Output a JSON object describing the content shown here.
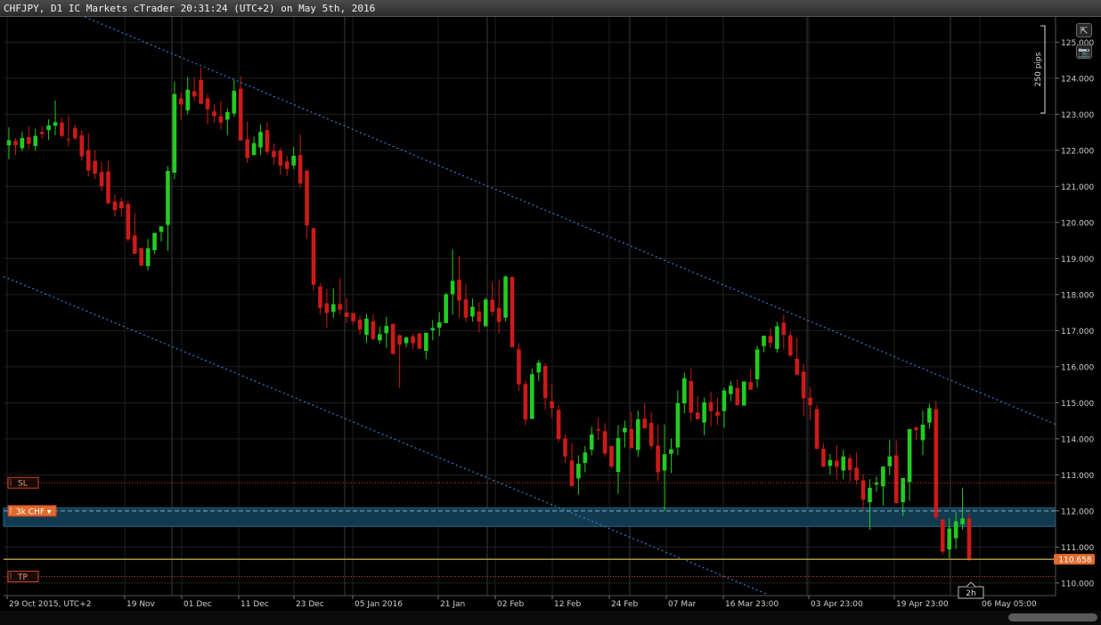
{
  "window": {
    "title": "CHFJPY, D1 IC Markets cTrader 20:31:24 (UTC+2) on May 5th, 2016"
  },
  "toolbar": {
    "expand_icon": "expand-icon",
    "camera_icon": "camera-icon",
    "expand_glyph": "⇱",
    "camera_glyph": "📷"
  },
  "chart_data": {
    "type": "candlestick",
    "symbol": "CHFJPY",
    "timeframe": "D1",
    "ylim": [
      109.65,
      125.7
    ],
    "y_ticks": [
      "110.000",
      "111.000",
      "112.000",
      "113.000",
      "114.000",
      "115.000",
      "116.000",
      "117.000",
      "118.000",
      "119.000",
      "120.000",
      "121.000",
      "122.000",
      "123.000",
      "124.000",
      "125.000"
    ],
    "x_labels": [
      "29 Oct 2015, UTC+2",
      "19 Nov",
      "01 Dec",
      "11 Dec",
      "23 Dec",
      "05 Jan 2016",
      "21 Jan",
      "02 Feb",
      "12 Feb",
      "24 Feb",
      "07 Mar",
      "16 Mar 23:00",
      "03 Apr 23:00",
      "19 Apr 23:00",
      "06 May 05:00"
    ],
    "current_price": "110.658",
    "scale_label": "250 pips",
    "countdown": "2h",
    "orders": {
      "sl": {
        "label": "SL",
        "price": 112.78
      },
      "position": {
        "label": "3k CHF",
        "price": 112.0,
        "zone": [
          111.57,
          112.08
        ]
      },
      "tp": {
        "label": "TP",
        "price": 110.18
      }
    },
    "trendlines": [
      {
        "style": "dotted",
        "from": [
          "Oct 2015",
          125.9
        ],
        "to": [
          "May 2016",
          114.4
        ]
      },
      {
        "style": "dotted",
        "from": [
          "Oct 2015",
          118.5
        ],
        "to": [
          "Mar 2016",
          109.7
        ]
      }
    ],
    "colors": {
      "up": "#22cc22",
      "down": "#cc1a1a",
      "price_tag": "#e06b2e",
      "zone": "#113a4f",
      "sl_tp": "#cc4422",
      "trend": "#2e7fd1",
      "current_line": "#b8a44a"
    },
    "candles": [
      [
        122.14,
        122.64,
        121.75,
        122.28
      ],
      [
        122.26,
        122.34,
        121.87,
        122.14
      ],
      [
        122.06,
        122.52,
        121.98,
        122.34
      ],
      [
        122.37,
        122.66,
        122.03,
        122.18
      ],
      [
        122.12,
        122.6,
        121.99,
        122.4
      ],
      [
        122.51,
        122.67,
        122.31,
        122.45
      ],
      [
        122.56,
        122.86,
        122.29,
        122.69
      ],
      [
        122.68,
        123.38,
        122.42,
        122.78
      ],
      [
        122.77,
        122.91,
        122.35,
        122.4
      ],
      [
        122.31,
        122.97,
        122.11,
        122.3
      ],
      [
        122.62,
        122.71,
        122.29,
        122.33
      ],
      [
        122.42,
        122.56,
        121.71,
        121.83
      ],
      [
        122.01,
        122.48,
        121.27,
        121.44
      ],
      [
        121.71,
        122.01,
        121.21,
        121.35
      ],
      [
        121.4,
        121.67,
        120.87,
        121.01
      ],
      [
        121.42,
        121.7,
        120.5,
        120.53
      ],
      [
        120.58,
        120.76,
        120.16,
        120.34
      ],
      [
        120.58,
        120.69,
        120.16,
        120.39
      ],
      [
        120.51,
        120.59,
        119.46,
        119.53
      ],
      [
        119.64,
        120.26,
        119.32,
        119.13
      ],
      [
        119.29,
        119.3,
        118.81,
        118.8
      ],
      [
        118.79,
        119.54,
        118.67,
        119.28
      ],
      [
        119.23,
        119.71,
        119.12,
        119.71
      ],
      [
        119.74,
        119.81,
        119.47,
        119.89
      ],
      [
        119.93,
        121.56,
        119.21,
        121.43
      ],
      [
        121.38,
        123.91,
        121.2,
        123.56
      ],
      [
        123.44,
        123.61,
        122.84,
        123.27
      ],
      [
        123.11,
        124.03,
        123.0,
        123.68
      ],
      [
        123.64,
        124.02,
        123.37,
        123.49
      ],
      [
        123.95,
        124.29,
        123.34,
        123.29
      ],
      [
        123.44,
        123.56,
        122.73,
        123.14
      ],
      [
        123.08,
        123.27,
        122.77,
        122.95
      ],
      [
        122.95,
        123.37,
        122.58,
        122.77
      ],
      [
        122.85,
        123.16,
        122.43,
        123.06
      ],
      [
        123.02,
        123.95,
        122.93,
        123.65
      ],
      [
        123.71,
        124.06,
        122.73,
        122.27
      ],
      [
        122.31,
        122.8,
        121.65,
        121.79
      ],
      [
        121.87,
        122.38,
        121.99,
        122.2
      ],
      [
        122.08,
        122.71,
        121.86,
        122.51
      ],
      [
        122.56,
        122.78,
        121.87,
        121.96
      ],
      [
        121.98,
        122.19,
        121.6,
        121.81
      ],
      [
        121.99,
        122.08,
        121.33,
        121.58
      ],
      [
        121.69,
        121.84,
        121.29,
        121.48
      ],
      [
        121.58,
        122.1,
        121.48,
        121.85
      ],
      [
        121.87,
        122.44,
        120.96,
        121.08
      ],
      [
        121.44,
        121.42,
        119.54,
        119.92
      ],
      [
        119.84,
        119.78,
        118.1,
        118.27
      ],
      [
        118.22,
        118.31,
        117.45,
        117.63
      ],
      [
        117.76,
        118.16,
        117.08,
        117.49
      ],
      [
        117.52,
        118.17,
        117.35,
        117.73
      ],
      [
        117.74,
        118.46,
        117.43,
        117.58
      ],
      [
        117.5,
        117.89,
        117.21,
        117.38
      ],
      [
        117.49,
        117.49,
        117.18,
        117.26
      ],
      [
        117.3,
        117.41,
        116.88,
        117.03
      ],
      [
        116.88,
        117.46,
        116.66,
        117.33
      ],
      [
        117.26,
        117.45,
        116.74,
        116.77
      ],
      [
        116.73,
        117.11,
        116.63,
        116.9
      ],
      [
        116.93,
        117.38,
        116.52,
        117.13
      ],
      [
        117.19,
        117.17,
        116.57,
        116.35
      ],
      [
        116.87,
        116.9,
        115.41,
        116.61
      ],
      [
        116.65,
        116.83,
        116.54,
        116.81
      ],
      [
        116.84,
        116.91,
        116.49,
        116.65
      ],
      [
        116.92,
        116.94,
        116.48,
        116.5
      ],
      [
        116.44,
        116.91,
        116.21,
        116.94
      ],
      [
        117.01,
        117.29,
        116.73,
        117.07
      ],
      [
        117.08,
        117.51,
        116.85,
        117.23
      ],
      [
        117.21,
        118.04,
        117.25,
        118.01
      ],
      [
        118.01,
        119.25,
        117.44,
        118.38
      ],
      [
        118.41,
        119.08,
        117.36,
        117.83
      ],
      [
        117.87,
        118.28,
        117.24,
        117.36
      ],
      [
        117.39,
        117.89,
        117.24,
        117.66
      ],
      [
        117.53,
        117.79,
        116.95,
        117.25
      ],
      [
        117.12,
        117.91,
        117.17,
        117.86
      ],
      [
        117.86,
        118.35,
        117.41,
        117.52
      ],
      [
        117.63,
        118.41,
        116.92,
        117.24
      ],
      [
        117.36,
        118.53,
        117.25,
        118.5
      ],
      [
        118.49,
        118.28,
        116.84,
        116.54
      ],
      [
        116.48,
        116.65,
        115.33,
        115.51
      ],
      [
        115.52,
        115.61,
        114.38,
        114.53
      ],
      [
        114.55,
        115.95,
        114.61,
        115.79
      ],
      [
        115.84,
        116.19,
        115.6,
        116.11
      ],
      [
        116.02,
        116.09,
        114.81,
        115.13
      ],
      [
        115.04,
        115.5,
        114.58,
        114.86
      ],
      [
        114.8,
        114.94,
        113.91,
        113.99
      ],
      [
        114.01,
        114.12,
        113.33,
        113.51
      ],
      [
        113.4,
        113.87,
        112.85,
        112.69
      ],
      [
        112.9,
        113.54,
        112.46,
        113.31
      ],
      [
        113.33,
        113.8,
        113.07,
        113.62
      ],
      [
        113.7,
        114.33,
        113.54,
        114.12
      ],
      [
        114.27,
        114.58,
        113.96,
        114.23
      ],
      [
        114.21,
        114.43,
        113.5,
        113.59
      ],
      [
        113.8,
        113.61,
        113.18,
        113.23
      ],
      [
        113.08,
        114.38,
        112.47,
        114.02
      ],
      [
        114.18,
        114.5,
        113.76,
        114.3
      ],
      [
        114.27,
        114.74,
        113.89,
        113.74
      ],
      [
        113.69,
        114.78,
        113.5,
        114.54
      ],
      [
        114.56,
        114.98,
        114.35,
        114.29
      ],
      [
        114.44,
        114.73,
        113.71,
        113.8
      ],
      [
        113.81,
        114.39,
        112.83,
        113.07
      ],
      [
        113.12,
        114.4,
        112.01,
        113.57
      ],
      [
        113.58,
        114.0,
        113.05,
        113.71
      ],
      [
        113.76,
        115.34,
        113.55,
        114.99
      ],
      [
        114.98,
        115.83,
        114.71,
        115.68
      ],
      [
        115.6,
        115.95,
        114.49,
        114.72
      ],
      [
        114.73,
        115.18,
        114.56,
        114.54
      ],
      [
        114.45,
        115.14,
        114.1,
        115.01
      ],
      [
        115.02,
        115.31,
        114.33,
        114.77
      ],
      [
        114.75,
        115.13,
        114.38,
        114.64
      ],
      [
        114.77,
        115.41,
        114.31,
        115.34
      ],
      [
        115.24,
        115.6,
        115.05,
        115.47
      ],
      [
        115.41,
        115.65,
        115.0,
        114.93
      ],
      [
        114.92,
        115.58,
        115.05,
        115.59
      ],
      [
        115.57,
        115.92,
        115.4,
        115.36
      ],
      [
        115.65,
        116.58,
        115.42,
        116.48
      ],
      [
        116.57,
        116.84,
        116.4,
        116.86
      ],
      [
        116.85,
        117.07,
        116.51,
        116.66
      ],
      [
        116.49,
        117.24,
        116.39,
        117.12
      ],
      [
        117.22,
        117.44,
        116.48,
        116.88
      ],
      [
        116.87,
        116.97,
        116.27,
        116.31
      ],
      [
        116.22,
        116.8,
        115.82,
        115.78
      ],
      [
        115.86,
        116.08,
        114.62,
        115.12
      ],
      [
        115.14,
        115.43,
        114.53,
        114.93
      ],
      [
        114.82,
        114.94,
        113.71,
        113.72
      ],
      [
        113.72,
        113.88,
        113.21,
        113.23
      ],
      [
        113.25,
        113.58,
        113.01,
        113.41
      ],
      [
        113.39,
        113.82,
        112.88,
        113.22
      ],
      [
        113.12,
        113.69,
        112.88,
        113.51
      ],
      [
        113.46,
        113.56,
        112.81,
        113.13
      ],
      [
        113.2,
        113.62,
        112.73,
        112.85
      ],
      [
        112.85,
        113.02,
        112.0,
        112.31
      ],
      [
        112.24,
        112.88,
        111.48,
        112.64
      ],
      [
        112.73,
        112.95,
        112.53,
        112.78
      ],
      [
        112.68,
        113.02,
        112.15,
        113.23
      ],
      [
        113.24,
        113.97,
        113.0,
        113.51
      ],
      [
        113.54,
        113.95,
        112.2,
        112.22
      ],
      [
        112.24,
        112.85,
        111.85,
        112.91
      ],
      [
        112.8,
        114.21,
        112.28,
        114.27
      ],
      [
        114.31,
        114.34,
        113.97,
        114.24
      ],
      [
        113.96,
        114.78,
        113.55,
        114.39
      ],
      [
        114.45,
        114.97,
        114.28,
        114.85
      ],
      [
        114.82,
        115.04,
        111.76,
        111.82
      ],
      [
        111.76,
        111.56,
        110.79,
        110.87
      ],
      [
        110.93,
        111.8,
        110.69,
        111.51
      ],
      [
        111.24,
        111.98,
        110.94,
        111.71
      ],
      [
        111.63,
        112.64,
        111.48,
        111.79
      ],
      [
        111.79,
        111.93,
        110.61,
        110.66
      ]
    ]
  }
}
